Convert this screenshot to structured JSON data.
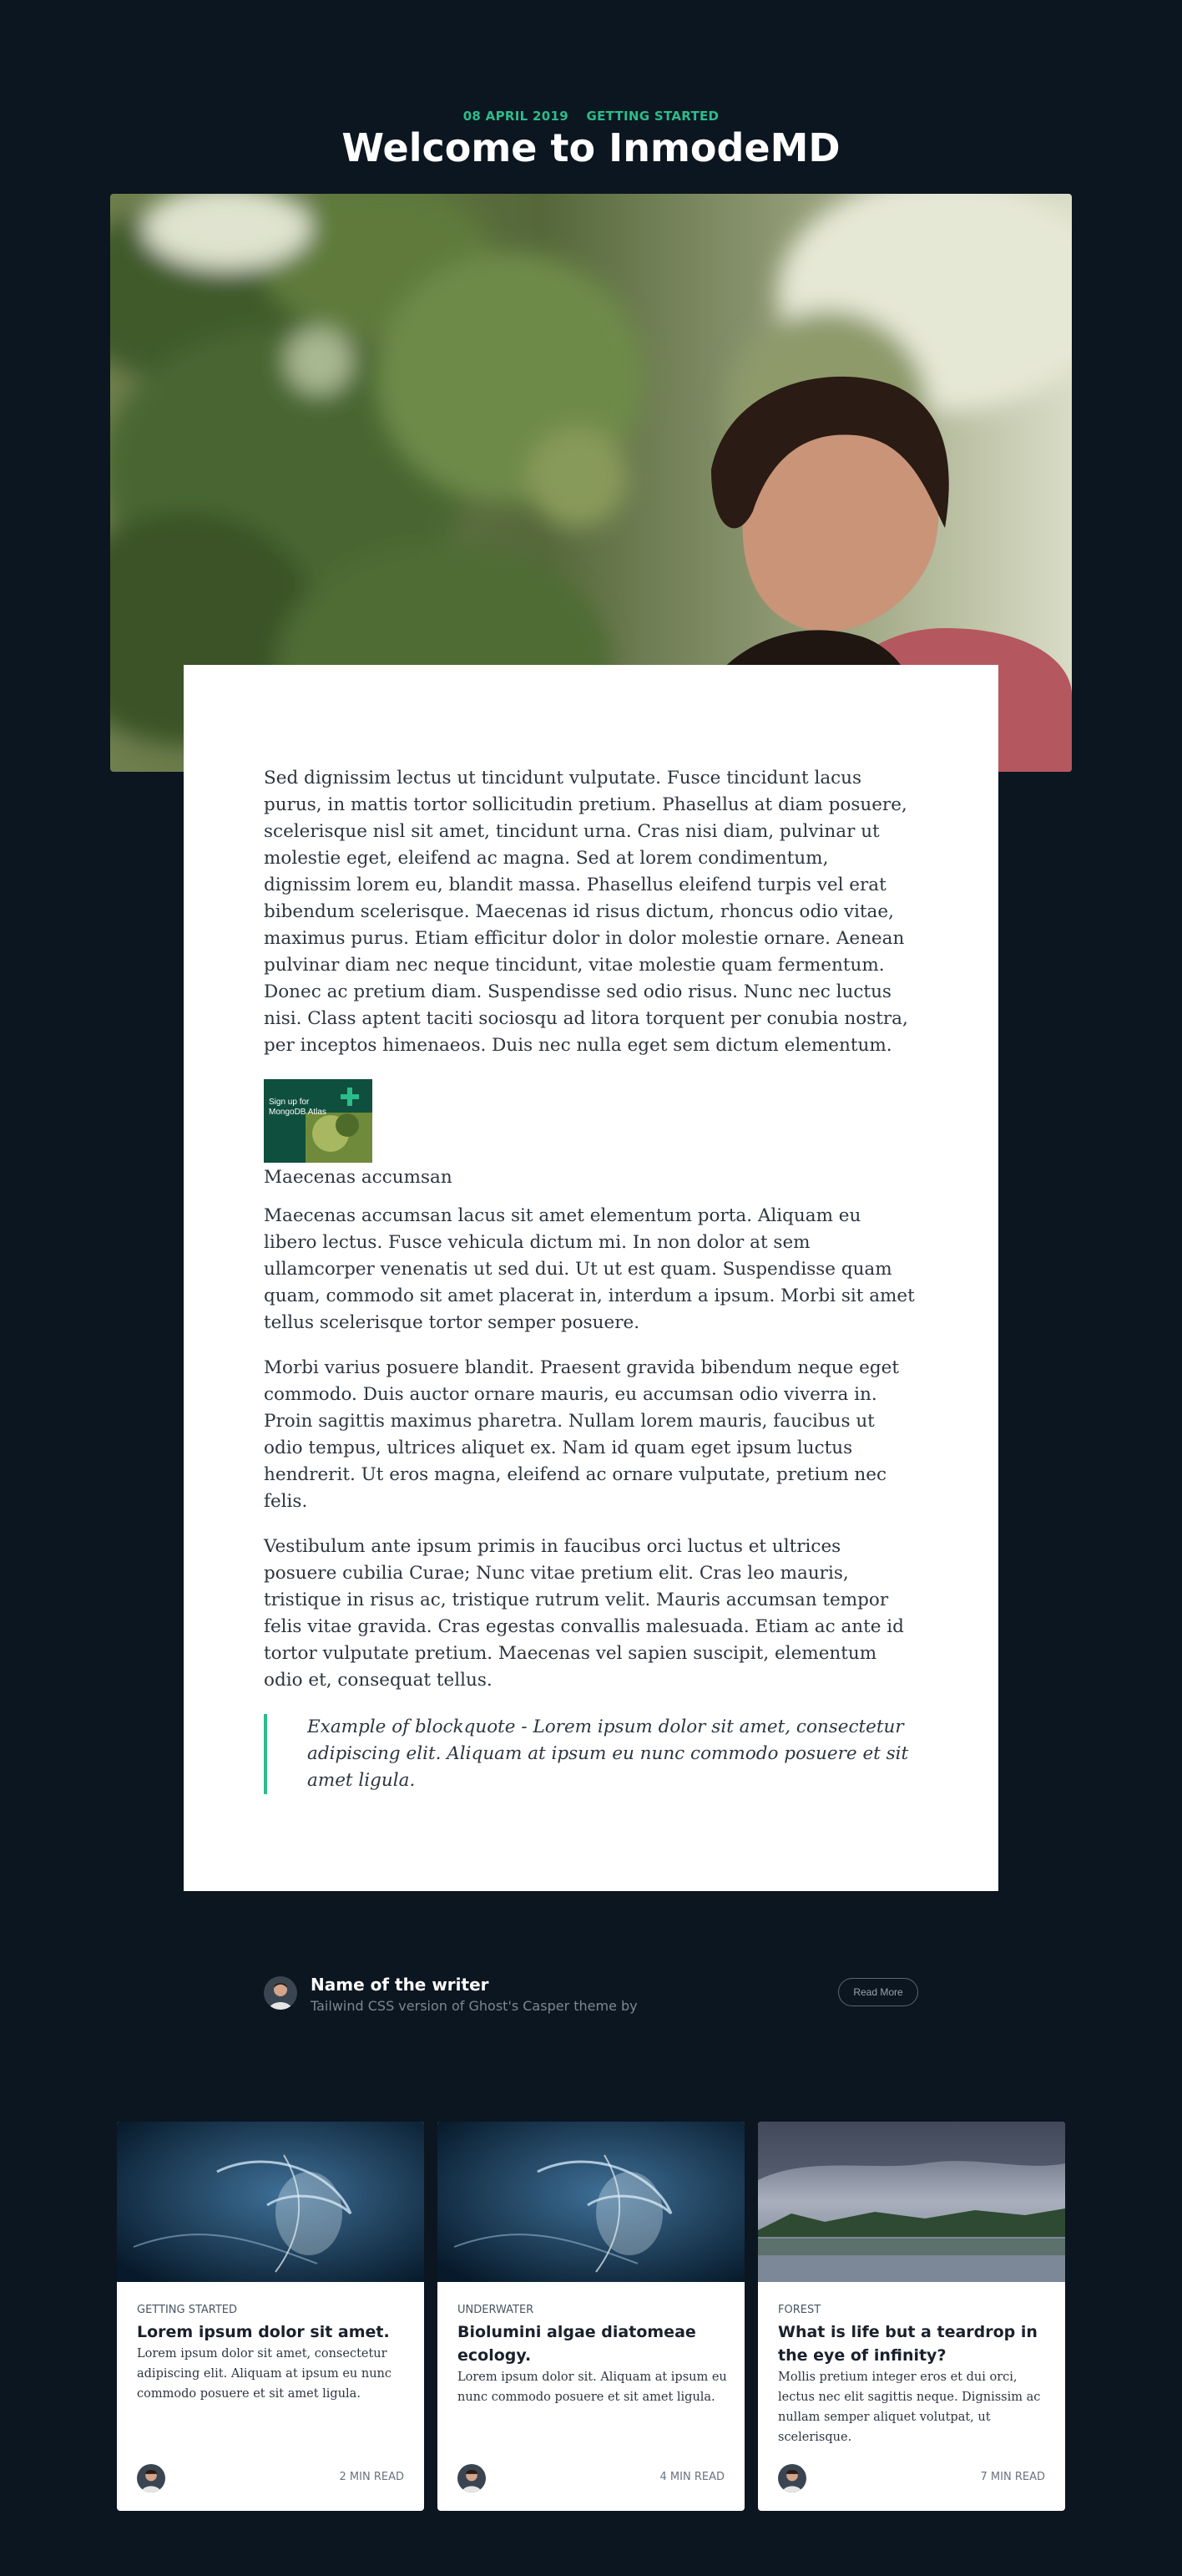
{
  "post": {
    "date": "08 APRIL 2019",
    "tag": "GETTING STARTED",
    "title": "Welcome to InmodeMD"
  },
  "article": {
    "paragraph1": "Sed dignissim lectus ut tincidunt vulputate. Fusce tincidunt lacus purus, in mattis tortor sollicitudin pretium. Phasellus at diam posuere, scelerisque nisl sit amet, tincidunt urna. Cras nisi diam, pulvinar ut molestie eget, eleifend ac magna. Sed at lorem condimentum, dignissim lorem eu, blandit massa. Phasellus eleifend turpis vel erat bibendum scelerisque. Maecenas id risus dictum, rhoncus odio vitae, maximus purus. Etiam efficitur dolor in dolor molestie ornare. Aenean pulvinar diam nec neque tincidunt, vitae molestie quam fermentum. Donec ac pretium diam. Suspendisse sed odio risus. Nunc nec luctus nisi. Class aptent taciti sociosqu ad litora torquent per conubia nostra, per inceptos himenaeos. Duis nec nulla eget sem dictum elementum.",
    "figure_caption": "Maecenas accumsan",
    "figure_image_text": "Sign up for MongoDB Atlas",
    "paragraph2": "Maecenas accumsan lacus sit amet elementum porta. Aliquam eu libero lectus. Fusce vehicula dictum mi. In non dolor at sem ullamcorper venenatis ut sed dui. Ut ut est quam. Suspendisse quam quam, commodo sit amet placerat in, interdum a ipsum. Morbi sit amet tellus scelerisque tortor semper posuere.",
    "paragraph3": "Morbi varius posuere blandit. Praesent gravida bibendum neque eget commodo. Duis auctor ornare mauris, eu accumsan odio viverra in. Proin sagittis maximus pharetra. Nullam lorem mauris, faucibus ut odio tempus, ultrices aliquet ex. Nam id quam eget ipsum luctus hendrerit. Ut eros magna, eleifend ac ornare vulputate, pretium nec felis.",
    "paragraph4": "Vestibulum ante ipsum primis in faucibus orci luctus et ultrices posuere cubilia Curae; Nunc vitae pretium elit. Cras leo mauris, tristique in risus ac, tristique rutrum velit. Mauris accumsan tempor felis vitae gravida. Cras egestas convallis malesuada. Etiam ac ante id tortor vulputate pretium. Maecenas vel sapien suscipit, elementum odio et, consequat tellus.",
    "blockquote": "Example of blockquote - Lorem ipsum dolor sit amet, consectetur adipiscing elit. Aliquam at ipsum eu nunc commodo posuere et sit amet ligula."
  },
  "author": {
    "name": "Name of the writer",
    "bio": "Tailwind CSS version of Ghost's Casper theme by",
    "read_more": "Read More"
  },
  "related": [
    {
      "tag": "GETTING STARTED",
      "title": "Lorem ipsum dolor sit amet.",
      "excerpt": "Lorem ipsum dolor sit amet, consectetur adipiscing elit. Aliquam at ipsum eu nunc commodo posuere et sit amet ligula.",
      "read_time": "2 MIN READ"
    },
    {
      "tag": "UNDERWATER",
      "title": "Biolumini algae diatomeae ecology.",
      "excerpt": "Lorem ipsum dolor sit. Aliquam at ipsum eu nunc commodo posuere et sit amet ligula.",
      "read_time": "4 MIN READ"
    },
    {
      "tag": "FOREST",
      "title": "What is life but a teardrop in the eye of infinity?",
      "excerpt": "Mollis pretium integer eros et dui orci, lectus nec elit sagittis neque. Dignissim ac nullam semper aliquet volutpat, ut scelerisque.",
      "read_time": "7 MIN READ"
    }
  ],
  "colors": {
    "page_background": "#0c1620",
    "accent": "#2bbc8a",
    "article_background": "#ffffff"
  }
}
